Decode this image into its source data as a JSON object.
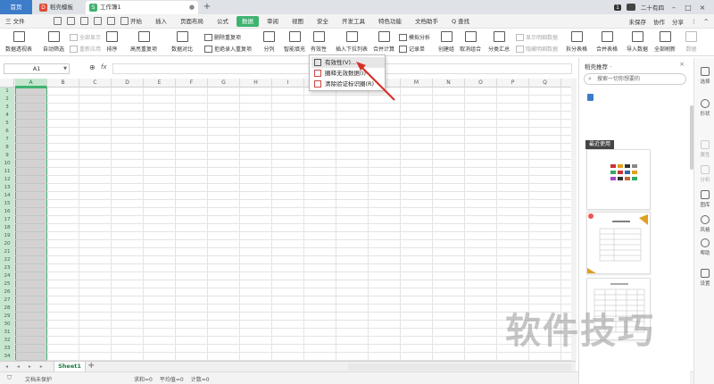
{
  "titlebar": {
    "home_tab": "首页",
    "tabs": [
      {
        "label": "稻壳模板",
        "icon_text": "D",
        "color": "#e04b36"
      },
      {
        "label": "工作簿1",
        "icon_text": "S",
        "color": "#3eb370"
      }
    ],
    "badge": "1",
    "user_name": "二十有四"
  },
  "menubar": {
    "file": "三 文件",
    "items": [
      "开始",
      "插入",
      "页面布局",
      "公式",
      "数据",
      "审阅",
      "视图",
      "安全",
      "开发工具",
      "特色功能",
      "文档助手"
    ],
    "active_item": "数据",
    "search": "Q 查找",
    "right_items": [
      "未保存",
      "协作",
      "分享"
    ]
  },
  "ribbon": {
    "pivot": "数据透视表",
    "autofilter": "自动筛选",
    "show_all": "全部显示",
    "reapply": "重新应用",
    "sort": "排序",
    "highlight_dup": "高亮重复项",
    "data_compare": "数据对比",
    "remove_dup": "删除重复项",
    "reject_dup": "拒绝录入重复项",
    "split": "分列",
    "smart_fill": "智能填充",
    "validity": "有效性",
    "insert_dropdown": "插入下拉列表",
    "consolidate": "合并计算",
    "simulate": "模拟分析",
    "record": "记录单",
    "create_group": "创建组",
    "ungroup": "取消组合",
    "subtotal": "分类汇总",
    "show_detail": "显示明细数据",
    "hide_detail": "隐藏明细数据",
    "split_table": "拆分表格",
    "merge_table": "合并表格",
    "import_data": "导入数据",
    "refresh_all": "全部刷新",
    "data_source": "数据"
  },
  "formula": {
    "cell_ref": "A1",
    "fx": "fx",
    "value": ""
  },
  "grid": {
    "columns": [
      "A",
      "B",
      "C",
      "D",
      "E",
      "F",
      "G",
      "H",
      "I",
      "J",
      "K",
      "L",
      "M",
      "N",
      "O",
      "P",
      "Q"
    ],
    "selected_column": "A",
    "rows": [
      "1",
      "2",
      "3",
      "4",
      "5",
      "6",
      "7",
      "8",
      "9",
      "10",
      "11",
      "12",
      "13",
      "14",
      "15",
      "16",
      "17",
      "18",
      "19",
      "20",
      "21",
      "22",
      "23",
      "24",
      "25",
      "26",
      "27",
      "28",
      "29",
      "30",
      "31",
      "32",
      "33",
      "34"
    ]
  },
  "sheets": {
    "active": "Sheet1",
    "add": "+"
  },
  "status": {
    "doc_state": "文档未保护",
    "sum": "求和=0",
    "average": "平均值=0",
    "count": "计数=0"
  },
  "dropdown": {
    "items": [
      "有效性(V)...",
      "圈释无效数据(I)",
      "清除验证标识圈(R)"
    ],
    "highlighted_index": 0
  },
  "panel": {
    "title": "稻壳推荐 ·",
    "close": "×",
    "search_placeholder": "搜索一切你想要的",
    "recent_label": "最近使用"
  },
  "sidetools": [
    "选择",
    "形状",
    "属性",
    "分析",
    "图库",
    "风格",
    "帮助",
    "设置"
  ],
  "watermark": "软件技巧",
  "colors": {
    "accent_green": "#3eb370",
    "home_tab_blue": "#3d7cc9",
    "arrow_red": "#d6302a"
  }
}
